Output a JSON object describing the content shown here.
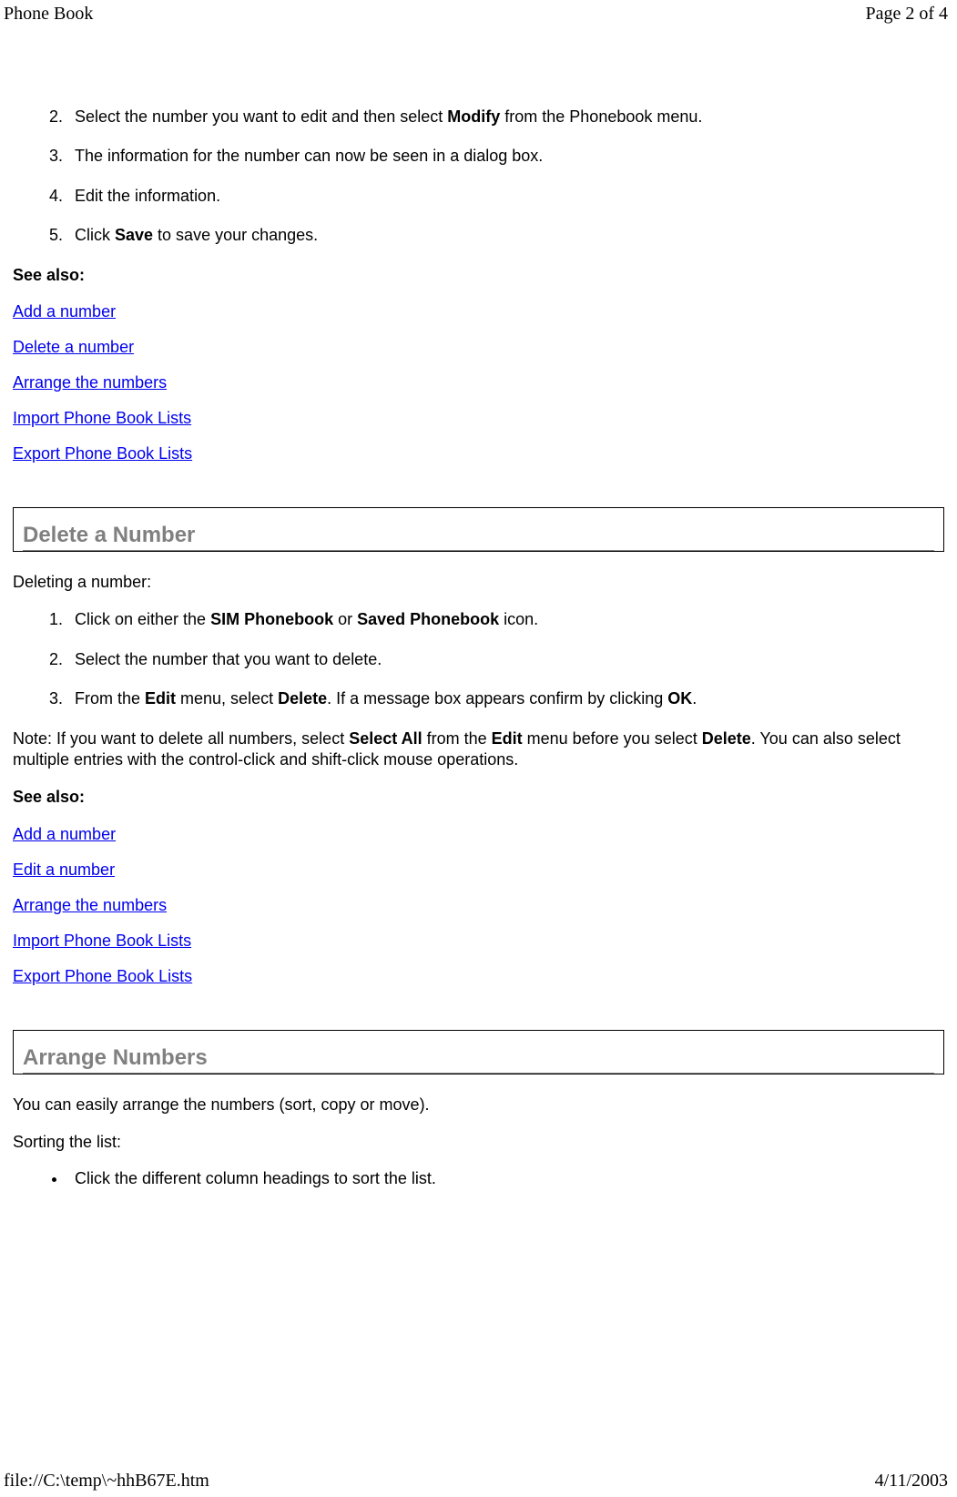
{
  "header": {
    "title": "Phone Book",
    "page_info": "Page 2 of 4"
  },
  "edit_section": {
    "steps": {
      "s2_a": "Select the number you want to edit and then select ",
      "s2_b": "Modify",
      "s2_c": " from the Phonebook menu.",
      "s3": "The information for the number can now be seen in a dialog box.",
      "s4": "Edit the information.",
      "s5_a": "Click ",
      "s5_b": "Save",
      "s5_c": " to save your changes."
    },
    "see_also_label": "See also:",
    "links": {
      "add": "Add a number",
      "delete": "Delete a number",
      "arrange": "Arrange the numbers",
      "import": "Import Phone Book Lists",
      "export": "Export Phone Book Lists"
    }
  },
  "delete_section": {
    "heading": "Delete a Number",
    "intro": "Deleting a number:",
    "steps": {
      "s1_a": "Click on either the ",
      "s1_b": "SIM Phonebook",
      "s1_c": " or ",
      "s1_d": "Saved Phonebook",
      "s1_e": " icon.",
      "s2": "Select the number that you want to delete.",
      "s3_a": "From the ",
      "s3_b": "Edit",
      "s3_c": " menu, select ",
      "s3_d": "Delete",
      "s3_e": ". If a message box appears confirm by clicking ",
      "s3_f": "OK",
      "s3_g": "."
    },
    "note_a": "Note: If you want to delete all numbers, select ",
    "note_b": "Select All",
    "note_c": " from the ",
    "note_d": "Edit",
    "note_e": " menu before you select ",
    "note_f": "Delete",
    "note_g": ". You can also select multiple entries with the control-click and shift-click mouse operations.",
    "see_also_label": "See also:",
    "links": {
      "add": "Add a number",
      "edit": "Edit a number",
      "arrange": "Arrange the numbers",
      "import": "Import Phone Book Lists",
      "export": "Export Phone Book Lists"
    }
  },
  "arrange_section": {
    "heading": "Arrange Numbers",
    "intro": "You can easily arrange the numbers (sort, copy or move).",
    "sorting_label": "Sorting the list:",
    "bullet1": "Click the different column headings to sort the list."
  },
  "footer": {
    "path": "file://C:\\temp\\~hhB67E.htm",
    "date": "4/11/2003"
  }
}
